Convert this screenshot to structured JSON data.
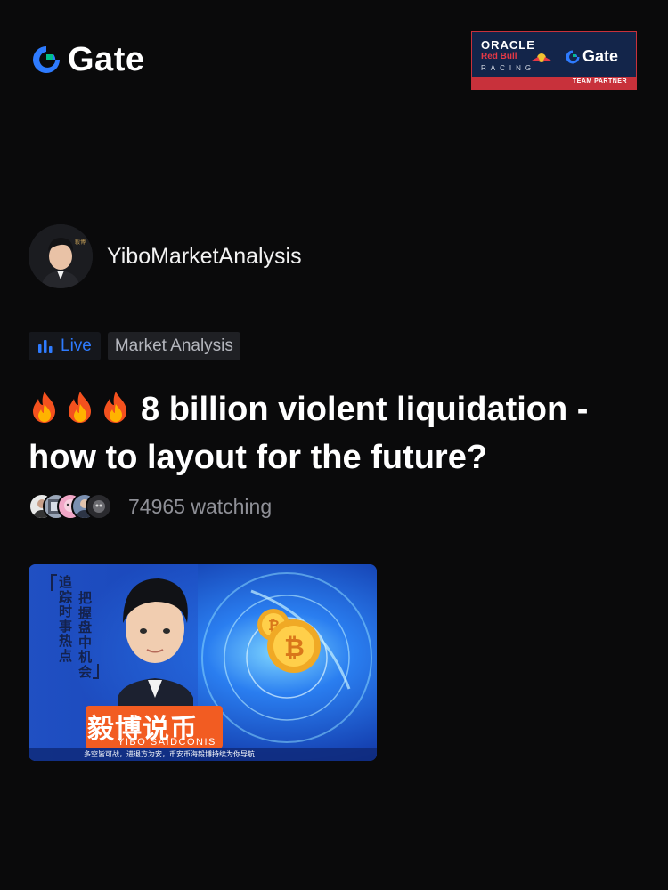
{
  "header": {
    "logo_text": "Gate",
    "partner": {
      "oracle": "ORACLE",
      "redbull": "Red Bull",
      "racing": "RACING",
      "gate": "Gate",
      "band": "TEAM PARTNER"
    }
  },
  "host": {
    "name": "YiboMarketAnalysis"
  },
  "tags": {
    "live": "Live",
    "category": "Market Analysis"
  },
  "title": {
    "emoji_count": 3,
    "text": "8 billion violent liquidation - how to layout for the future?"
  },
  "watching": {
    "text": "74965 watching"
  },
  "thumbnail": {
    "vertical_left": "追踪时事热点",
    "vertical_right": "把握盘中机会",
    "brand_cn": "毅博说币",
    "brand_en": "YIBO SAIDCONIS",
    "slogan": "多空皆可战，进退方为安，币安币海毅博持续为你导航"
  },
  "colors": {
    "background": "#0a0a0b",
    "accent_blue": "#2e7bff",
    "logo_green": "#00c089",
    "brand_orange": "#f25c22"
  }
}
